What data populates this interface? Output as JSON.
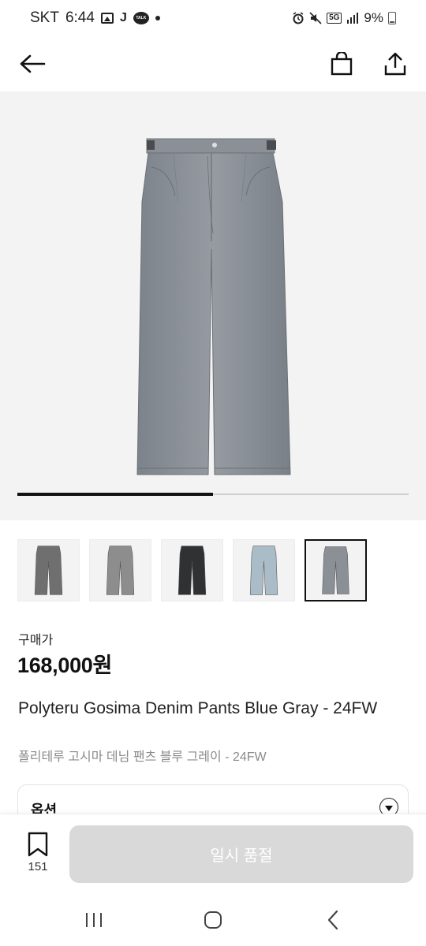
{
  "status_bar": {
    "carrier": "SKT",
    "time": "6:44",
    "notif_j": "J",
    "talk_label": "TALK",
    "network": "5G",
    "battery": "9%"
  },
  "header": {
    "back_icon": "arrow-left-icon",
    "bag_icon": "shopping-bag-icon",
    "share_icon": "share-upload-icon"
  },
  "gallery": {
    "progress_fraction": 0.5,
    "thumbnails": [
      {
        "tone": "#6f6f6f",
        "selected": false
      },
      {
        "tone": "#8d8d8d",
        "selected": false
      },
      {
        "tone": "#2f3133",
        "selected": false
      },
      {
        "tone": "#a9bcc8",
        "selected": false
      },
      {
        "tone": "#8a9096",
        "selected": true
      }
    ]
  },
  "price": {
    "label": "구매가",
    "value": "168,000원"
  },
  "product": {
    "name": "Polyteru Gosima Denim Pants Blue Gray - 24FW",
    "name_ko": "폴리테루 고시마 데님 팬츠 블루 그레이 - 24FW"
  },
  "option": {
    "label": "옵션"
  },
  "bottom_bar": {
    "bookmark_count": "151",
    "cta_label": "일시 품절",
    "cta_color": "#d9d9d9"
  }
}
